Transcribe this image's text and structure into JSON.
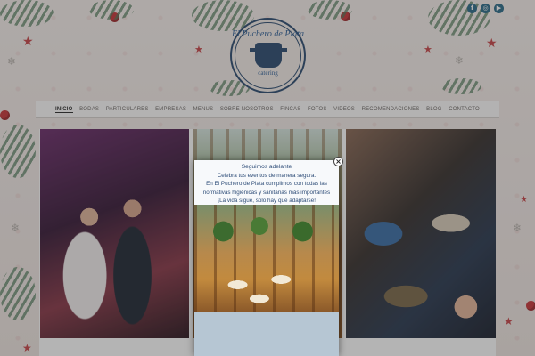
{
  "site": {
    "logo_name": "El Puchero de Plata",
    "logo_sub": "catering"
  },
  "social": [
    {
      "icon": "facebook-icon",
      "glyph": "f"
    },
    {
      "icon": "instagram-icon",
      "glyph": "◎"
    },
    {
      "icon": "youtube-icon",
      "glyph": "▶"
    }
  ],
  "nav": {
    "items": [
      {
        "label": "INICIO",
        "active": true
      },
      {
        "label": "BODAS"
      },
      {
        "label": "PARTICULARES"
      },
      {
        "label": "EMPRESAS"
      },
      {
        "label": "MENUS"
      },
      {
        "label": "SOBRE NOSOTROS"
      },
      {
        "label": "FINCAS"
      },
      {
        "label": "FOTOS"
      },
      {
        "label": "VIDEOS"
      },
      {
        "label": "RECOMENDACIONES"
      },
      {
        "label": "BLOG"
      },
      {
        "label": "CONTACTO"
      }
    ]
  },
  "popup": {
    "title": "Seguimos adelante",
    "line1": "Celebra tus eventos de manera segura.",
    "line2": "En El Puchero de Plata cumplimos con todas las normativas higiénicas y sanitarias más importantes",
    "line3": "¡La vida sigue, solo hay que adaptarse!",
    "close_glyph": "×"
  },
  "colors": {
    "brand": "#2f4e72",
    "popup_text": "#2e4d78",
    "accent_red": "#c8383b"
  }
}
